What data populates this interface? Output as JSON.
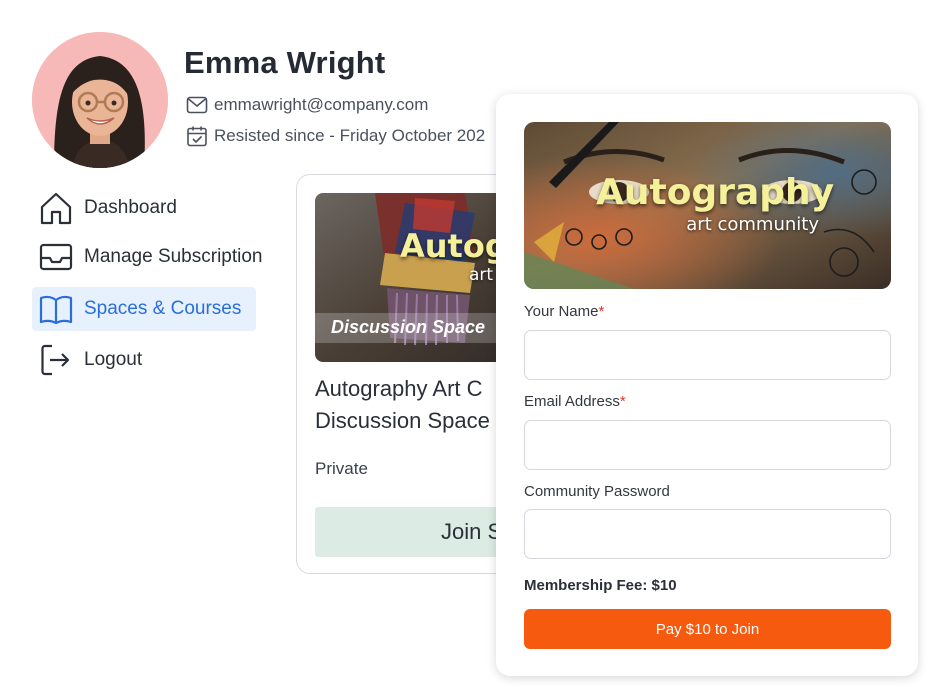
{
  "profile": {
    "name": "Emma Wright",
    "email": "emmawright@company.com",
    "since": "Resisted since - Friday October 202"
  },
  "sidebar": {
    "items": [
      {
        "label": "Dashboard",
        "icon": "home-icon",
        "active": false
      },
      {
        "label": "Manage Subscription",
        "icon": "inbox-icon",
        "active": false
      },
      {
        "label": "Spaces & Courses",
        "icon": "book-open-icon",
        "active": true
      },
      {
        "label": "Logout",
        "icon": "logout-icon",
        "active": false
      }
    ]
  },
  "course_card": {
    "image_title": "Autog",
    "image_subtitle": "art",
    "image_caption": "Discussion Space",
    "title_line1": "Autography Art C",
    "title_line2": "Discussion Space",
    "privacy": "Private",
    "join_label": "Join S"
  },
  "join_form": {
    "banner_title": "Autography",
    "banner_subtitle": "art community",
    "name_label": "Your Name",
    "email_label": "Email Address",
    "password_label": "Community Password",
    "required_mark": "*",
    "fee_text": "Membership Fee: $10",
    "pay_label": "Pay $10 to Join"
  },
  "colors": {
    "accent_blue": "#2a6fd8",
    "active_bg": "#e7f0fd",
    "pay_orange": "#f55a0f",
    "join_green_bg": "#dcece5",
    "required_red": "#e0352b"
  }
}
